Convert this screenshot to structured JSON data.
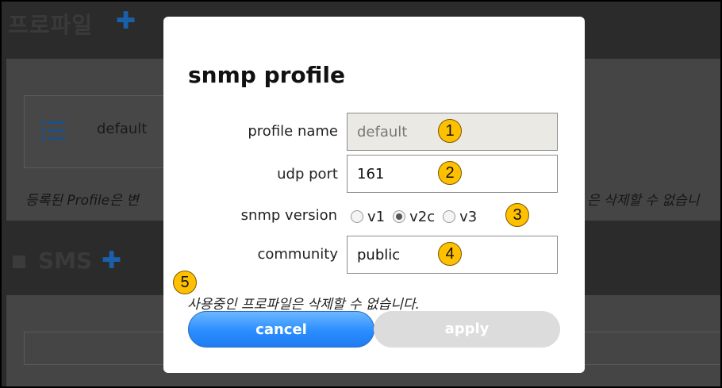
{
  "background": {
    "section_title": "프로파일",
    "add_icon": "plus-icon",
    "profile_item": "default",
    "list_icon": "list-icon",
    "notice_left": "등록된 Profile은 변",
    "notice_right": "은 삭제할 수 없습니",
    "sms_title": "SMS"
  },
  "dialog": {
    "title": "snmp profile",
    "profile_name": {
      "label": "profile name",
      "value": "default"
    },
    "udp_port": {
      "label": "udp port",
      "value": "161"
    },
    "snmp_version": {
      "label": "snmp version",
      "options": [
        "v1",
        "v2c",
        "v3"
      ],
      "selected": "v2c"
    },
    "community": {
      "label": "community",
      "value": "public"
    },
    "notice": "사용중인 프로파일은 삭제할 수 없습니다.",
    "cancel_label": "cancel",
    "apply_label": "apply"
  },
  "markers": [
    "1",
    "2",
    "3",
    "4",
    "5"
  ],
  "colors": {
    "marker": "#ffc000",
    "cancel_button": "#2b8dff",
    "apply_button_disabled": "#dcdcdc",
    "plus_icon": "#1b5fa8"
  }
}
